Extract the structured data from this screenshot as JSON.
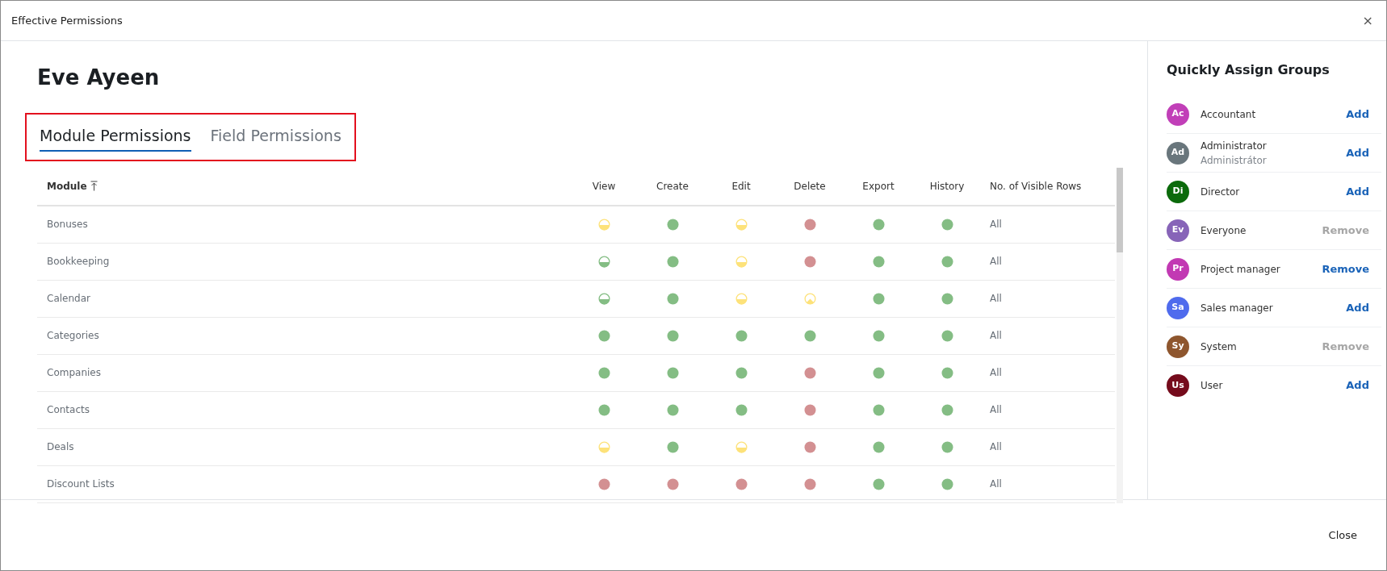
{
  "window": {
    "title": "Effective Permissions",
    "close": "×"
  },
  "user_name": "Eve Ayeen",
  "tabs_highlighted": true,
  "tabs": [
    {
      "label": "Module Permissions",
      "selected": true
    },
    {
      "label": "Field Permissions",
      "selected": false
    }
  ],
  "table": {
    "columns": [
      {
        "label": "Module",
        "sort_icon": true
      },
      {
        "label": "View"
      },
      {
        "label": "Create"
      },
      {
        "label": "Edit"
      },
      {
        "label": "Delete"
      },
      {
        "label": "Export"
      },
      {
        "label": "History"
      },
      {
        "label": "No. of Visible Rows"
      }
    ],
    "rows": [
      {
        "module": "Bonuses",
        "perms": [
          {
            "kind": "half_yellow"
          },
          {
            "kind": "full"
          },
          {
            "kind": "half_yellow"
          },
          {
            "kind": "none"
          },
          {
            "kind": "full"
          },
          {
            "kind": "full"
          }
        ],
        "visible_rows": "All"
      },
      {
        "module": "Bookkeeping",
        "perms": [
          {
            "kind": "half_green"
          },
          {
            "kind": "full"
          },
          {
            "kind": "half_yellow"
          },
          {
            "kind": "none"
          },
          {
            "kind": "full"
          },
          {
            "kind": "full"
          }
        ],
        "visible_rows": "All"
      },
      {
        "module": "Calendar",
        "perms": [
          {
            "kind": "half_green"
          },
          {
            "kind": "full"
          },
          {
            "kind": "half_yellow"
          },
          {
            "kind": "peak_yellow"
          },
          {
            "kind": "full"
          },
          {
            "kind": "full"
          }
        ],
        "visible_rows": "All"
      },
      {
        "module": "Categories",
        "perms": [
          {
            "kind": "full"
          },
          {
            "kind": "full"
          },
          {
            "kind": "full"
          },
          {
            "kind": "full"
          },
          {
            "kind": "full"
          },
          {
            "kind": "full"
          }
        ],
        "visible_rows": "All"
      },
      {
        "module": "Companies",
        "perms": [
          {
            "kind": "full"
          },
          {
            "kind": "full"
          },
          {
            "kind": "full"
          },
          {
            "kind": "none"
          },
          {
            "kind": "full"
          },
          {
            "kind": "full"
          }
        ],
        "visible_rows": "All"
      },
      {
        "module": "Contacts",
        "perms": [
          {
            "kind": "full"
          },
          {
            "kind": "full"
          },
          {
            "kind": "full"
          },
          {
            "kind": "none"
          },
          {
            "kind": "full"
          },
          {
            "kind": "full"
          }
        ],
        "visible_rows": "All"
      },
      {
        "module": "Deals",
        "perms": [
          {
            "kind": "half_yellow"
          },
          {
            "kind": "full"
          },
          {
            "kind": "half_yellow"
          },
          {
            "kind": "none"
          },
          {
            "kind": "full"
          },
          {
            "kind": "full"
          }
        ],
        "visible_rows": "All"
      },
      {
        "module": "Discount Lists",
        "perms": [
          {
            "kind": "none"
          },
          {
            "kind": "none"
          },
          {
            "kind": "none"
          },
          {
            "kind": "none"
          },
          {
            "kind": "full"
          },
          {
            "kind": "full"
          }
        ],
        "visible_rows": "All"
      }
    ]
  },
  "groups_panel": {
    "title": "Quickly Assign Groups",
    "items": [
      {
        "initials": "Ac",
        "color": "#c13fb8",
        "name": "Accountant",
        "action": "Add",
        "disabled": false
      },
      {
        "initials": "Ad",
        "color": "#69767c",
        "name": "Administrator",
        "subtitle": "Administrátor",
        "action": "Add",
        "disabled": false
      },
      {
        "initials": "Di",
        "color": "#0b6a0b",
        "name": "Director",
        "action": "Add",
        "disabled": false
      },
      {
        "initials": "Ev",
        "color": "#8764b8",
        "name": "Everyone",
        "action": "Remove",
        "disabled": true
      },
      {
        "initials": "Pr",
        "color": "#c239b3",
        "name": "Project manager",
        "action": "Remove",
        "disabled": false
      },
      {
        "initials": "Sa",
        "color": "#4f6bed",
        "name": "Sales manager",
        "action": "Add",
        "disabled": false
      },
      {
        "initials": "Sy",
        "color": "#8e562e",
        "name": "System",
        "action": "Remove",
        "disabled": true
      },
      {
        "initials": "Us",
        "color": "#750b1c",
        "name": "User",
        "action": "Add",
        "disabled": false
      }
    ]
  },
  "footer": {
    "close_button": "Close"
  }
}
